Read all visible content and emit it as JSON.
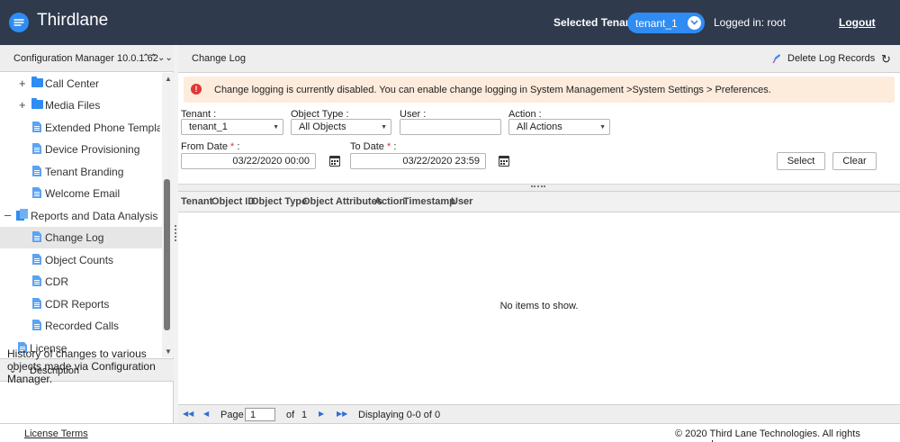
{
  "header": {
    "brand": "Thirdlane",
    "tenant_label": "Selected Tenant :",
    "tenant_value": "tenant_1",
    "logged_in": "Logged in: root",
    "logout": "Logout"
  },
  "sidebar": {
    "title": "Configuration Manager 10.0.1.62",
    "items": [
      {
        "label": "Call Center",
        "type": "folder",
        "expandable": true
      },
      {
        "label": "Media Files",
        "type": "folder",
        "expandable": true
      },
      {
        "label": "Extended Phone Templat...",
        "type": "doc"
      },
      {
        "label": "Device Provisioning",
        "type": "doc"
      },
      {
        "label": "Tenant Branding",
        "type": "doc"
      },
      {
        "label": "Welcome Email",
        "type": "doc"
      },
      {
        "label": "Reports and Data Analysis",
        "type": "group",
        "expanded": true
      },
      {
        "label": "Change Log",
        "type": "doc",
        "active": true
      },
      {
        "label": "Object Counts",
        "type": "doc"
      },
      {
        "label": "CDR",
        "type": "doc"
      },
      {
        "label": "CDR Reports",
        "type": "doc"
      },
      {
        "label": "Recorded Calls",
        "type": "doc"
      },
      {
        "label": "License",
        "type": "doc"
      }
    ],
    "description_title": "Description",
    "description_text": "History of changes to various objects made via Configuration Manager."
  },
  "main": {
    "title": "Change Log",
    "delete_label": "Delete Log Records",
    "alert": "Change logging is currently disabled. You can enable change logging in System Management >System Settings > Preferences.",
    "filters": {
      "tenant_label": "Tenant :",
      "tenant_value": "tenant_1",
      "object_type_label": "Object Type :",
      "object_type_value": "All Objects",
      "user_label": "User :",
      "user_value": "",
      "action_label": "Action :",
      "action_value": "All Actions",
      "from_date_label": "From Date",
      "from_date_value": "03/22/2020 00:00",
      "to_date_label": "To Date",
      "to_date_value": "03/22/2020 23:59",
      "required_mark": "*",
      "select_button": "Select",
      "clear_button": "Clear"
    },
    "table": {
      "columns": [
        "Tenant",
        "Object ID",
        "Object Type",
        "Object Attributes",
        "Action",
        "Timestamp",
        "User"
      ],
      "empty_message": "No items to show."
    },
    "pager": {
      "page_label": "Page",
      "page_value": "1",
      "of_label": "of",
      "total_pages": "1",
      "displaying": "Displaying 0-0 of 0"
    }
  },
  "footer": {
    "license_terms": "License Terms",
    "copyright": "© 2020 Third Lane Technologies. All rights reserved."
  },
  "colors": {
    "header_bg": "#2f3a4d",
    "accent": "#2f8cf3",
    "alert_bg": "#fdebdc",
    "alert_icon": "#e03636"
  }
}
